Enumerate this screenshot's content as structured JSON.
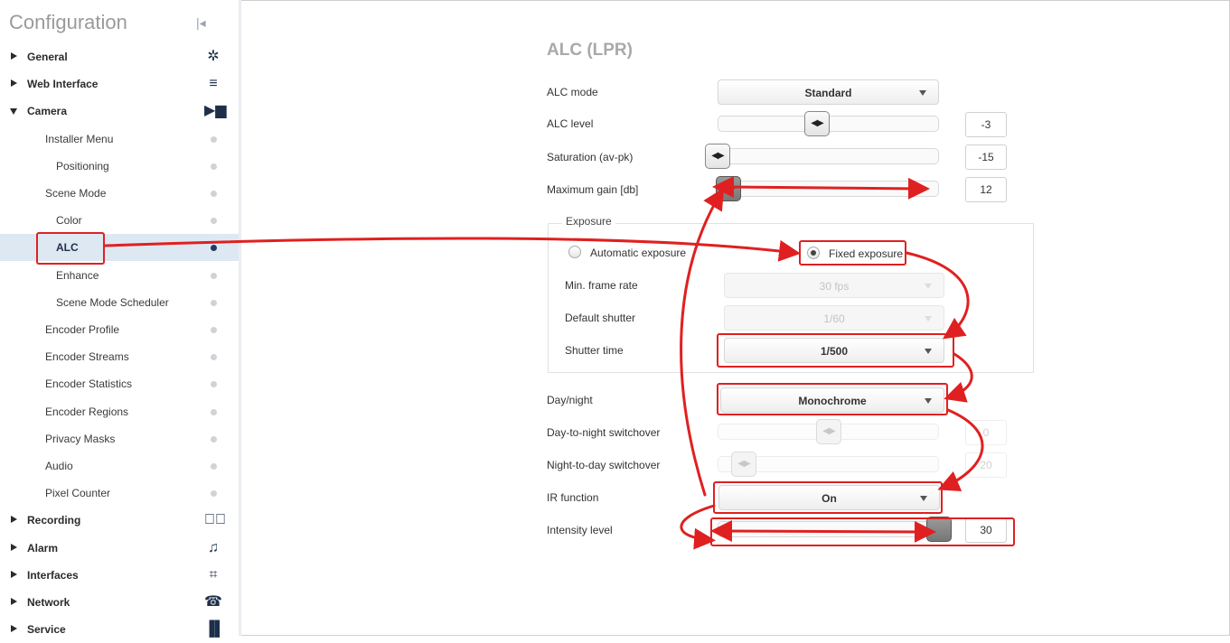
{
  "sidebar": {
    "title": "Configuration",
    "items": [
      {
        "label": "General",
        "level": 0,
        "expanded": false,
        "icon": "gear-icon"
      },
      {
        "label": "Web Interface",
        "level": 0,
        "expanded": false,
        "icon": "menu-lines-icon"
      },
      {
        "label": "Camera",
        "level": 0,
        "expanded": true,
        "icon": "camera-icon"
      },
      {
        "label": "Installer Menu",
        "level": 1
      },
      {
        "label": "Positioning",
        "level": 2
      },
      {
        "label": "Scene Mode",
        "level": 1
      },
      {
        "label": "Color",
        "level": 2
      },
      {
        "label": "ALC",
        "level": 2,
        "selected": true
      },
      {
        "label": "Enhance",
        "level": 2
      },
      {
        "label": "Scene Mode Scheduler",
        "level": 2
      },
      {
        "label": "Encoder Profile",
        "level": 1
      },
      {
        "label": "Encoder Streams",
        "level": 1
      },
      {
        "label": "Encoder Statistics",
        "level": 1
      },
      {
        "label": "Encoder Regions",
        "level": 1
      },
      {
        "label": "Privacy Masks",
        "level": 1
      },
      {
        "label": "Audio",
        "level": 1
      },
      {
        "label": "Pixel Counter",
        "level": 1
      },
      {
        "label": "Recording",
        "level": 0,
        "expanded": false,
        "icon": "recording-icon"
      },
      {
        "label": "Alarm",
        "level": 0,
        "expanded": false,
        "icon": "bell-icon"
      },
      {
        "label": "Interfaces",
        "level": 0,
        "expanded": false,
        "icon": "interfaces-icon"
      },
      {
        "label": "Network",
        "level": 0,
        "expanded": false,
        "icon": "network-icon"
      },
      {
        "label": "Service",
        "level": 0,
        "expanded": false,
        "icon": "bar-chart-icon"
      }
    ]
  },
  "main": {
    "heading": "ALC (LPR)",
    "alc_mode": {
      "label": "ALC mode",
      "value": "Standard"
    },
    "alc_level": {
      "label": "ALC level",
      "value": "-3",
      "fraction": 0.45
    },
    "saturation": {
      "label": "Saturation (av-pk)",
      "value": "-15",
      "fraction": 0.0
    },
    "max_gain": {
      "label": "Maximum gain [db]",
      "value": "12",
      "fraction": 0.05
    },
    "exposure": {
      "legend": "Exposure",
      "auto_label": "Automatic exposure",
      "fixed_label": "Fixed exposure",
      "selected": "fixed",
      "min_frame_rate": {
        "label": "Min. frame rate",
        "value": "30 fps",
        "enabled": false
      },
      "default_shutter": {
        "label": "Default shutter",
        "value": "1/60",
        "enabled": false
      },
      "shutter_time": {
        "label": "Shutter time",
        "value": "1/500",
        "enabled": true
      }
    },
    "day_night": {
      "label": "Day/night",
      "value": "Monochrome"
    },
    "day_to_night": {
      "label": "Day-to-night switchover",
      "value": "0",
      "enabled": false,
      "fraction": 0.5
    },
    "night_to_day": {
      "label": "Night-to-day switchover",
      "value": "20",
      "enabled": false,
      "fraction": 0.12
    },
    "ir_function": {
      "label": "IR function",
      "value": "On"
    },
    "intensity": {
      "label": "Intensity level",
      "value": "30",
      "fraction": 1.0
    }
  },
  "colors": {
    "accent": "#1f3b64",
    "selection": "#dde8f3",
    "annotation": "#e02020"
  }
}
